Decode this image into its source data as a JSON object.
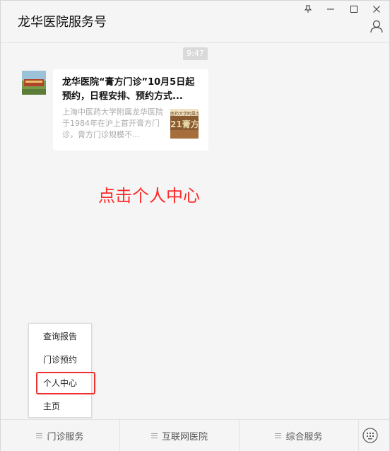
{
  "window": {
    "title": "龙华医院服务号",
    "controls": [
      "pin-icon",
      "minimize-icon",
      "maximize-icon",
      "close-icon"
    ],
    "profile_icon": "person-icon"
  },
  "chat": {
    "timestamp": "9:47",
    "article": {
      "title": "龙华医院“膏方门诊”10月5日起预约，日程安排、预约方式...",
      "description": "上海中医药大学附属龙华医院于1984年在沪上首开膏方门诊，膏方门诊规模不...",
      "thumb_text": "21膏方",
      "thumb_sub": "医药大学附属龙华"
    }
  },
  "annotation": {
    "text": "点击个人中心",
    "color": "#ff2a2a"
  },
  "popup_menu": {
    "items": [
      {
        "label": "查询报告"
      },
      {
        "label": "门诊预约"
      },
      {
        "label": "个人中心"
      },
      {
        "label": "主页"
      }
    ],
    "highlighted": "个人中心"
  },
  "bottom_menu": {
    "tabs": [
      {
        "label": "门诊服务"
      },
      {
        "label": "互联网医院"
      },
      {
        "label": "综合服务"
      }
    ],
    "keyboard_icon": "keyboard-icon"
  },
  "colors": {
    "background": "#f5f5f5",
    "highlight_border": "#f03030"
  }
}
